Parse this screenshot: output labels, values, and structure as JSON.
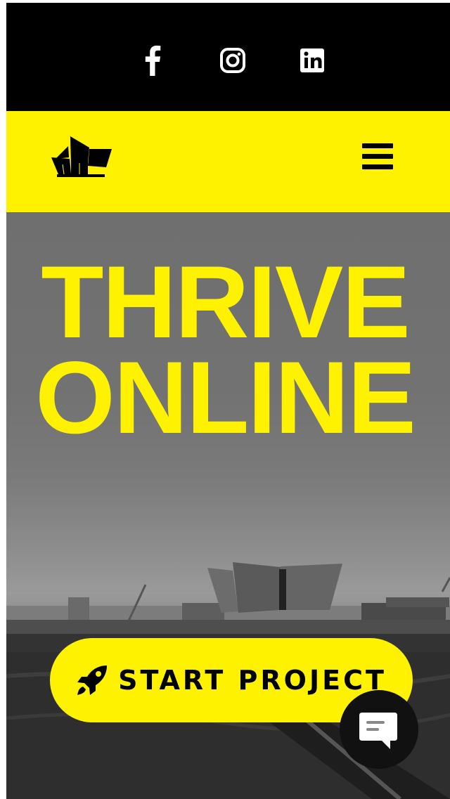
{
  "social": {
    "items": [
      {
        "name": "facebook",
        "icon": "facebook-icon"
      },
      {
        "name": "instagram",
        "icon": "instagram-icon"
      },
      {
        "name": "linkedin",
        "icon": "linkedin-icon"
      }
    ]
  },
  "header": {
    "logo_icon": "titanic-building-logo",
    "menu_icon": "hamburger-menu-icon"
  },
  "hero": {
    "title_line1": "THRIVE",
    "title_line2": "ONLINE",
    "cta_label": "START PROJECT",
    "cta_icon": "rocket-icon"
  },
  "chat": {
    "icon": "chat-bubble-icon"
  },
  "colors": {
    "brand_yellow": "#fff200",
    "bar_black": "#000000",
    "text_dark": "#000000"
  }
}
